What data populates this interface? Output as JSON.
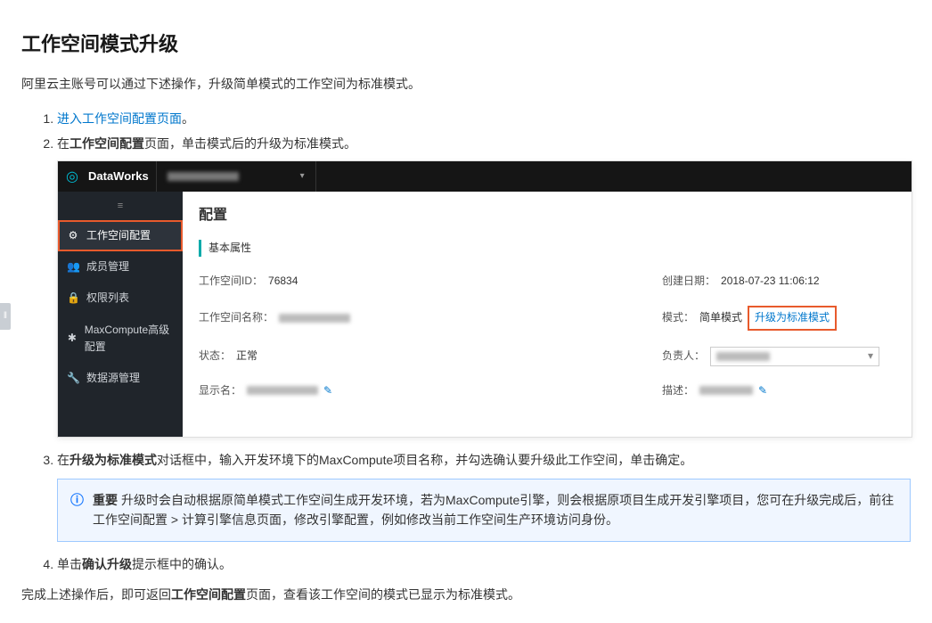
{
  "page": {
    "title": "工作空间模式升级",
    "intro": "阿里云主账号可以通过下述操作，升级简单模式的工作空间为标准模式。"
  },
  "steps": {
    "s1_link": "进入工作空间配置页面",
    "s1_suffix": "。",
    "s2_prefix": "在",
    "s2_bold": "工作空间配置",
    "s2_suffix": "页面，单击模式后的升级为标准模式。",
    "s3_prefix": "在",
    "s3_bold": "升级为标准模式",
    "s3_suffix": "对话框中，输入开发环境下的MaxCompute项目名称，并勾选确认要升级此工作空间，单击确定。",
    "s4_prefix": "单击",
    "s4_bold": "确认升级",
    "s4_suffix": "提示框中的确认。"
  },
  "alert": {
    "label": "重要",
    "text": "升级时会自动根据原简单模式工作空间生成开发环境，若为MaxCompute引擎，则会根据原项目生成开发引擎项目，您可在升级完成后，前往工作空间配置 > 计算引擎信息页面，修改引擎配置，例如修改当前工作空间生产环境访问身份。"
  },
  "conclusion": {
    "prefix": "完成上述操作后，即可返回",
    "bold": "工作空间配置",
    "suffix": "页面，查看该工作空间的模式已显示为标准模式。"
  },
  "dw": {
    "brand": "DataWorks",
    "sidebar": [
      {
        "icon": "⚙",
        "label": "工作空间配置"
      },
      {
        "icon": "👥",
        "label": "成员管理"
      },
      {
        "icon": "🔒",
        "label": "权限列表"
      },
      {
        "icon": "✱",
        "label": "MaxCompute高级配置"
      },
      {
        "icon": "🔧",
        "label": "数据源管理"
      }
    ],
    "main": {
      "title": "配置",
      "section": "基本属性",
      "ws_id_label": "工作空间ID：",
      "ws_id_value": "76834",
      "ws_name_label": "工作空间名称：",
      "status_label": "状态：",
      "status_value": "正常",
      "display_label": "显示名：",
      "create_label": "创建日期：",
      "create_value": "2018-07-23 11:06:12",
      "mode_label": "模式：",
      "mode_value": "简单模式",
      "upgrade_link": "升级为标准模式",
      "owner_label": "负责人：",
      "desc_label": "描述："
    }
  }
}
